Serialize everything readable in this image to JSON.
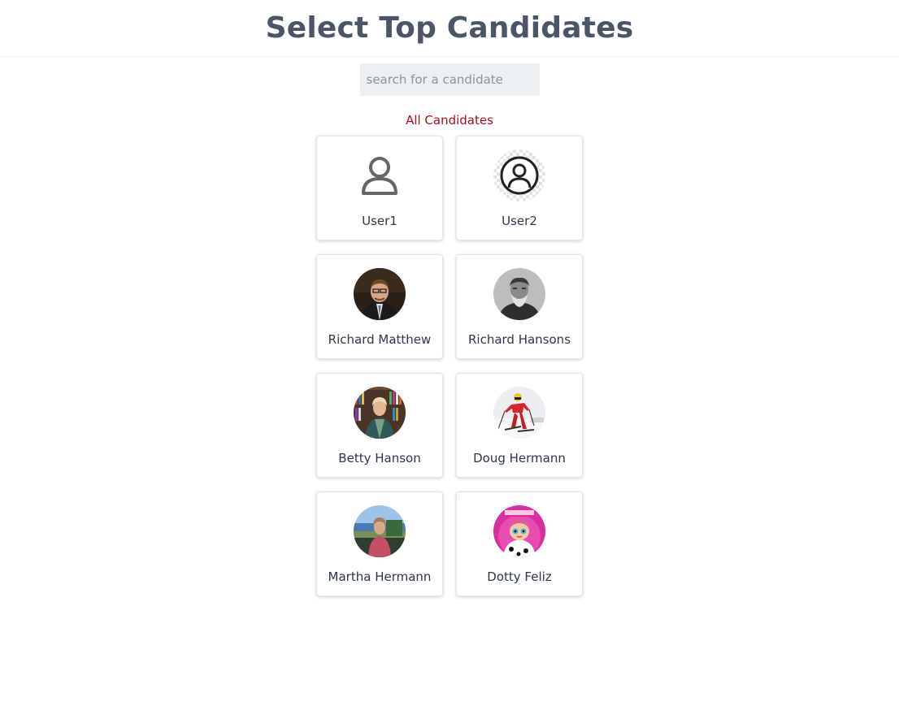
{
  "header": {
    "title": "Select Top Candidates"
  },
  "search": {
    "placeholder": "search for a candidate",
    "value": ""
  },
  "filter": {
    "all_label": "All Candidates"
  },
  "colors": {
    "title": "#4a5568",
    "link": "#a3101a",
    "search_bg": "#edf0f3"
  },
  "candidates": [
    {
      "name": "User1",
      "avatar": "generic-user-icon"
    },
    {
      "name": "User2",
      "avatar": "circled-user-icon"
    },
    {
      "name": "Richard Matthew",
      "avatar": "portrait-photo"
    },
    {
      "name": "Richard Hansons",
      "avatar": "portrait-photo"
    },
    {
      "name": "Betty Hanson",
      "avatar": "portrait-photo"
    },
    {
      "name": "Doug Hermann",
      "avatar": "skier-photo"
    },
    {
      "name": "Martha Hermann",
      "avatar": "portrait-photo"
    },
    {
      "name": "Dotty Feliz",
      "avatar": "cartoon-photo"
    }
  ]
}
